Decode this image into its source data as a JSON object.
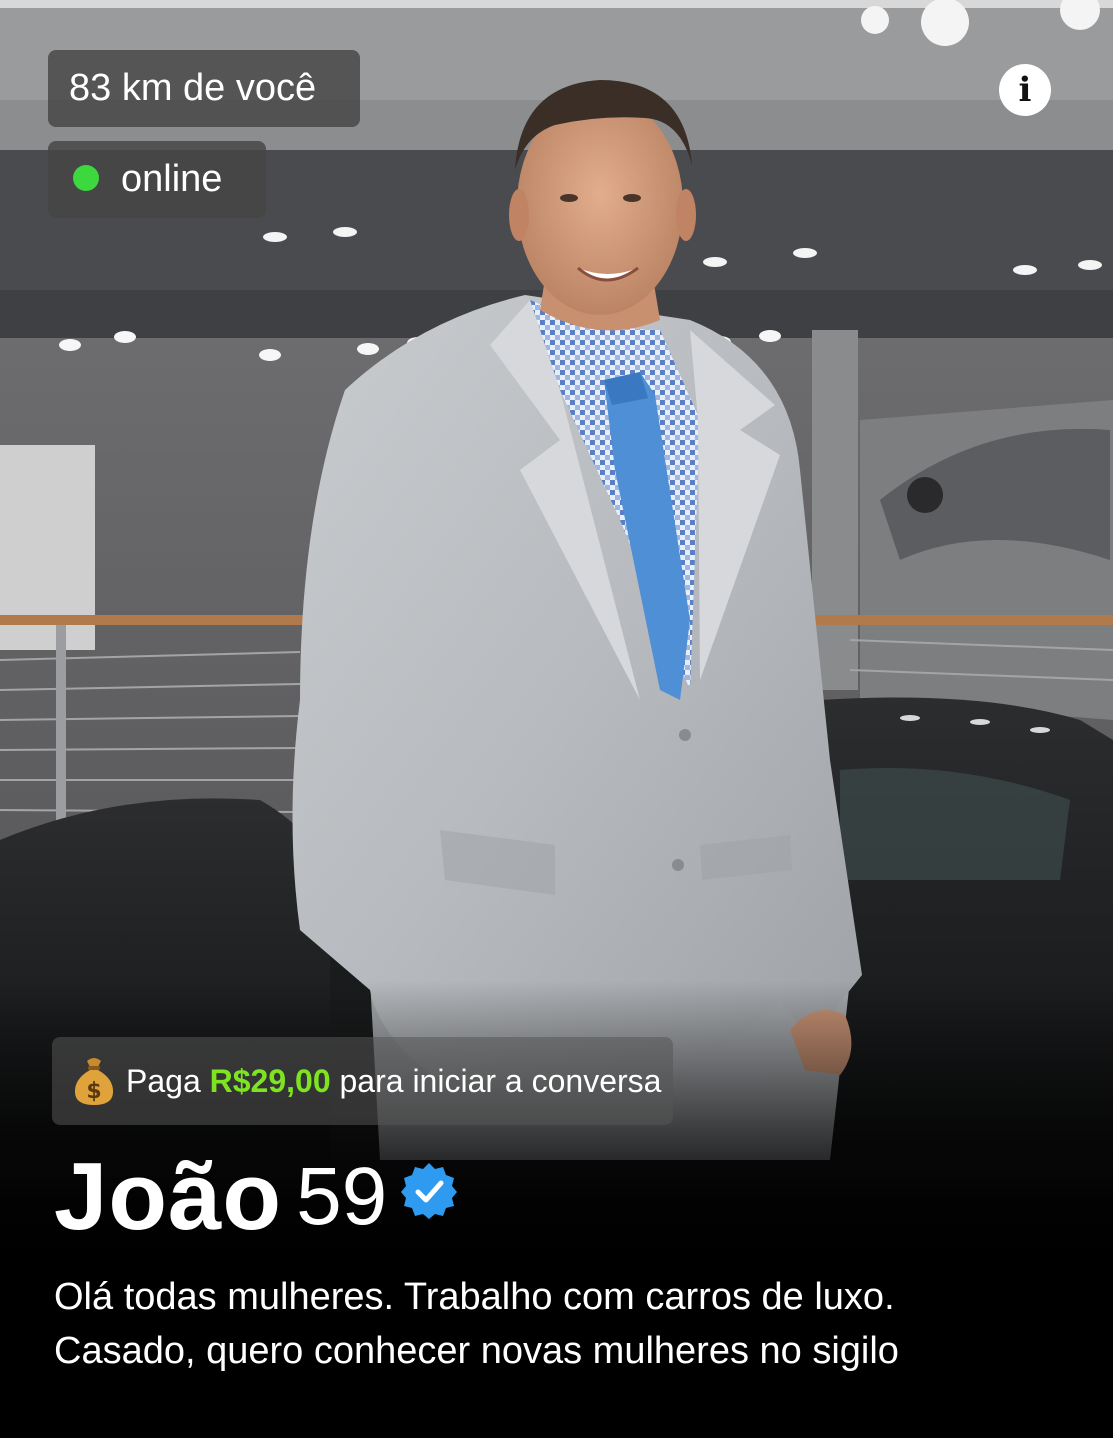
{
  "profile": {
    "distance": "83 km de você",
    "status": "online",
    "pay_prefix": "Paga",
    "pay_amount": "R$29,00",
    "pay_suffix": "para iniciar a conversa",
    "name": "João",
    "age": "59",
    "bio_line_1": "Olá todas mulheres. Trabalho com carros de luxo.",
    "bio_line_2": "Casado, quero conhecer novas mulheres no sigilo"
  },
  "icons": {
    "info": "i",
    "money": "money-bag-icon",
    "verified": "verified-badge-icon"
  },
  "colors": {
    "status_online": "#3dd83d",
    "pay_amount": "#7ee421",
    "verified": "#2f9bf0"
  }
}
